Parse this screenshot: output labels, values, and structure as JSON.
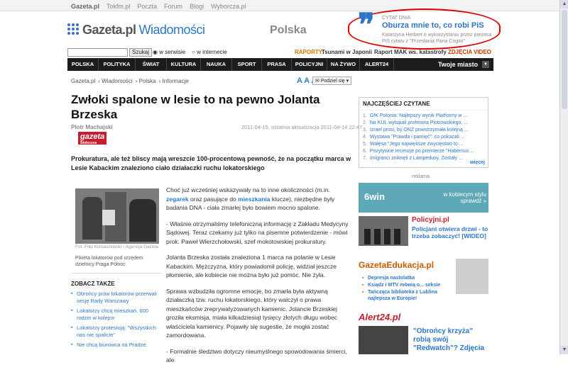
{
  "topbar": {
    "items": [
      "Gazeta.pl",
      "Tokfm.pl",
      "Poczta",
      "Forum",
      "Blogi",
      "Wyborcza.pl"
    ]
  },
  "header": {
    "logo_main": "Gazeta.pl",
    "logo_sub": "Wiadomości",
    "section": "Polska"
  },
  "quote": {
    "label": "CYTAT DNIA",
    "text": "Oburza mnie to, co robi PiS",
    "sub": "Katarzyna Herbert o wykorzystaniu przez prezesa PiS cytatu z \"Przesłania Pana Cogito\""
  },
  "search": {
    "button": "Szukaj",
    "opt1": "w serwisie",
    "opt2": "w internecie",
    "raporty_label": "RAPORTY:",
    "raport1": "Tsunami w Japonii",
    "raport2": "Raport MAK ws. katastrofy",
    "zdjecia": "ZDJĘCIA",
    "video": "VIDEO"
  },
  "nav": {
    "items": [
      "POLSKA",
      "POLITYKA",
      "ŚWIAT",
      "KULTURA",
      "NAUKA",
      "SPORT",
      "PRASA",
      "POLICYJNI",
      "NA ŻYWO",
      "ALERT24"
    ],
    "city": "Twoje miasto"
  },
  "breadcrumb": {
    "items": [
      "Gazeta.pl",
      "Wiadomości",
      "Polska",
      "Informacje"
    ],
    "font_sizes": "A A A",
    "share": "Podziel się"
  },
  "article": {
    "title": "Zwłoki spalone w lesie to na pewno Jolanta Brzeska",
    "author": "Piotr Machajski",
    "date": "2011-04-15, ostatnia aktualizacja 2011-04-14 22:47",
    "source_logo": "gazeta",
    "source_logo_sub": "Stołeczna",
    "lead": "Prokuratura, ale też bliscy mają wreszcie 100-procentową pewność, że na początku marca w Lesie Kabackim znaleziono ciało działaczki ruchu lokatorskiego",
    "photo_credit": "Fot. Filip Klimaszewski / Agencja Gazeta",
    "photo_caption": "Pikieta lokatorów pod urzędem dzielnicy Praga Północ",
    "paragraphs": [
      {
        "a": "Choć już wcześniej wskazywały na to inne okoliczności (m.in. ",
        "b1": "zegarek",
        "c": " oraz pasujące do ",
        "b2": "mieszkania",
        "d": " klucze), niezbędne były badania DNA - ciała zmarłej było bowiem mocno spalone."
      },
      {
        "text": "- Właśnie otrzymaliśmy telefoniczną informację z Zakładu Medycyny Sądowej. Teraz czekamy już tylko na pisemne potwierdzenie - mówi prok. Paweł Wierzchołowski, szef mokotowskiej prokuratury."
      },
      {
        "text": "Jolanta Brzeska została znaleziona 1 marca na polanie w Lesie Kabackim. Mężczyzna, który powiadomił policję, widział jeszcze płomienie, ale kobiecie nie można było już pomóc. Nie żyła."
      },
      {
        "text": "Sprawa wzbudziła ogromne emocje, bo zmarła była aktywną działaczką tzw. ruchu lokatorskiego, który walczył o prawa mieszkańców zreprywatyzowanych kamienic. Jolancie Brzeskiej groziła eksmisja, miała kilkadziesiąt tysięcy złotych długu wobec właściciela kamienicy. Pojawiły się sugestie, że mogła zostać zamordowana."
      },
      {
        "text": "- Formalnie śledztwo dotyczy nieumyślnego spowodowania śmierci, ale"
      }
    ]
  },
  "zobacz": {
    "heading": "ZOBACZ TAKŻE",
    "items": [
      "Obrońcy praw lokatorów przerwali sesję Rady Warszawy",
      "Lokatorzy chcą mieszkań. 600 rodzin w kolejce",
      "Lokatorzy protestują: \"Wszystkich nas nie spalicie\"",
      "Nie chcą biurowca na Pradze."
    ]
  },
  "najczesciej": {
    "heading": "NAJCZĘŚCIEJ CZYTANE",
    "items": [
      "GfK Polonia: Najlepszy wynik Platformy w ...",
      "Na KUL wytupali profesora Piotrowskiego, ...",
      "Izrael prosi, by ONZ powstrzymała kolejną ...",
      "Wystawa \"Prawda i pamięć\": co pokazali ...",
      "Wałęsa:\"Jego największe zwycięstwo to ...",
      "Pozytywne recenzje po premierze \"Habemus ...",
      "Imigranci zniknęli z Lampedusy. Zostały ..."
    ],
    "more": "więcej"
  },
  "ads": {
    "reklama": "reklama",
    "ad1_left": "6win",
    "ad1_right": "w kobiecym stylu sprawdź »",
    "policyjni_logo": "Policyjni.pl",
    "policyjni_text": "Policjant otwiera drzwi - to trzeba zobaczyć! [WIDEO]",
    "edu_logo": "GazetaEdukacja.pl",
    "edu_items": [
      "Depresja nastolatka",
      "Ksiądz i MTV mówią o... seksie",
      "Tańcząca biblioteka z Lublina najlepsza w Europie!"
    ],
    "alert_logo": "Alert24.pl",
    "alert_text": "\"Obrońcy krzyża\" robią swój \"Redwatch\"? Zdjęcia"
  }
}
